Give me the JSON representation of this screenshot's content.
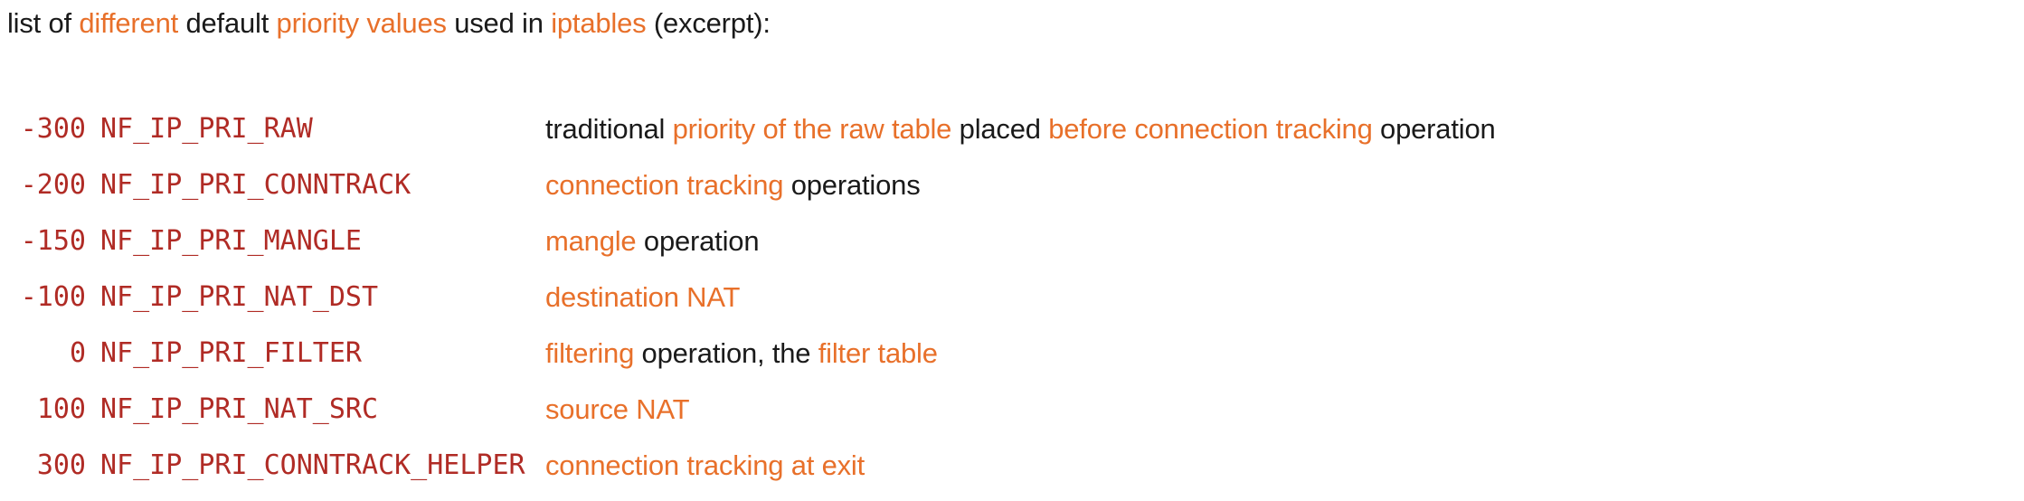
{
  "colors": {
    "background": "#ffffff",
    "body_text": "#1a1a1a",
    "accent_orange": "#E8702A",
    "mono_red": "#B02B25"
  },
  "intro": {
    "segments": [
      {
        "text": "list of ",
        "style": "plain"
      },
      {
        "text": "different",
        "style": "accent"
      },
      {
        "text": " default ",
        "style": "plain"
      },
      {
        "text": "priority values",
        "style": "accent"
      },
      {
        "text": " used in ",
        "style": "plain"
      },
      {
        "text": "iptables",
        "style": "accent"
      },
      {
        "text": " (excerpt):",
        "style": "plain"
      }
    ],
    "plain_text": "list of different default priority values used in iptables (excerpt):"
  },
  "table": {
    "rows": [
      {
        "value": "-300",
        "constant": "NF_IP_PRI_RAW",
        "description_plain": "traditional priority of the raw table placed before connection tracking operation",
        "description_segments": [
          {
            "text": "traditional ",
            "style": "plain"
          },
          {
            "text": "priority of the raw table",
            "style": "accent"
          },
          {
            "text": " placed ",
            "style": "plain"
          },
          {
            "text": "before connection tracking",
            "style": "accent"
          },
          {
            "text": " operation",
            "style": "plain"
          }
        ]
      },
      {
        "value": "-200",
        "constant": "NF_IP_PRI_CONNTRACK",
        "description_plain": "connection tracking operations",
        "description_segments": [
          {
            "text": "connection tracking",
            "style": "accent"
          },
          {
            "text": " operations",
            "style": "plain"
          }
        ]
      },
      {
        "value": "-150",
        "constant": "NF_IP_PRI_MANGLE",
        "description_plain": "mangle operation",
        "description_segments": [
          {
            "text": "mangle",
            "style": "accent"
          },
          {
            "text": " operation",
            "style": "plain"
          }
        ]
      },
      {
        "value": "-100",
        "constant": "NF_IP_PRI_NAT_DST",
        "description_plain": "destination NAT",
        "description_segments": [
          {
            "text": "destination NAT",
            "style": "accent"
          }
        ]
      },
      {
        "value": "0",
        "constant": "NF_IP_PRI_FILTER",
        "description_plain": "filtering operation, the filter table",
        "description_segments": [
          {
            "text": "filtering",
            "style": "accent"
          },
          {
            "text": " operation, the ",
            "style": "plain"
          },
          {
            "text": "filter table",
            "style": "accent"
          }
        ]
      },
      {
        "value": "100",
        "constant": "NF_IP_PRI_NAT_SRC",
        "description_plain": "source NAT",
        "description_segments": [
          {
            "text": "source NAT",
            "style": "accent"
          }
        ]
      },
      {
        "value": "300",
        "constant": "NF_IP_PRI_CONNTRACK_HELPER",
        "description_plain": "connection tracking at exit",
        "description_segments": [
          {
            "text": "connection tracking at exit",
            "style": "accent"
          }
        ]
      }
    ]
  }
}
